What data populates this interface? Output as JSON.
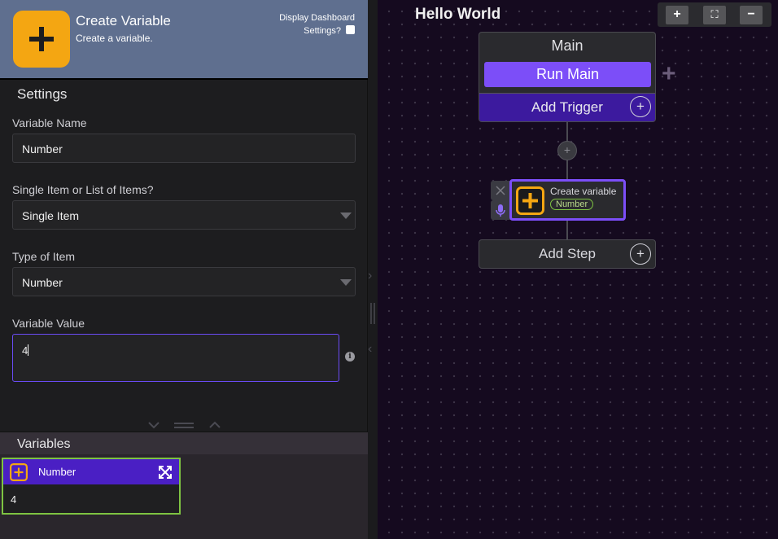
{
  "left_panel": {
    "header": {
      "title": "Create Variable",
      "subtitle": "Create a variable.",
      "dashboard_label_line1": "Display Dashboard",
      "dashboard_label_line2": "Settings?",
      "dashboard_checked": false
    },
    "settings_title": "Settings",
    "fields": {
      "variable_name_label": "Variable Name",
      "variable_name_value": "Number",
      "single_or_list_label": "Single Item or List of Items?",
      "single_or_list_value": "Single Item",
      "type_label": "Type of Item",
      "type_value": "Number",
      "value_label": "Variable Value",
      "value_value": "4",
      "info_icon": "i"
    },
    "variables": {
      "title": "Variables",
      "items": [
        {
          "name": "Number",
          "value": "4"
        }
      ]
    }
  },
  "canvas": {
    "flow_title": "Hello World",
    "zoom": {
      "zoom_in": "+",
      "fit": "⛶",
      "zoom_out": "−"
    },
    "main_card": {
      "title": "Main",
      "run_button": "Run Main",
      "add_trigger": "Add Trigger"
    },
    "step": {
      "title": "Create variable",
      "badge": "Number"
    },
    "add_step": "Add Step"
  },
  "colors": {
    "accent_purple": "#7c4ef8",
    "trigger_purple": "#3c1a9e",
    "icon_orange": "#f4a612",
    "variable_green": "#7ec342",
    "header_blue": "#5f6f8f"
  }
}
